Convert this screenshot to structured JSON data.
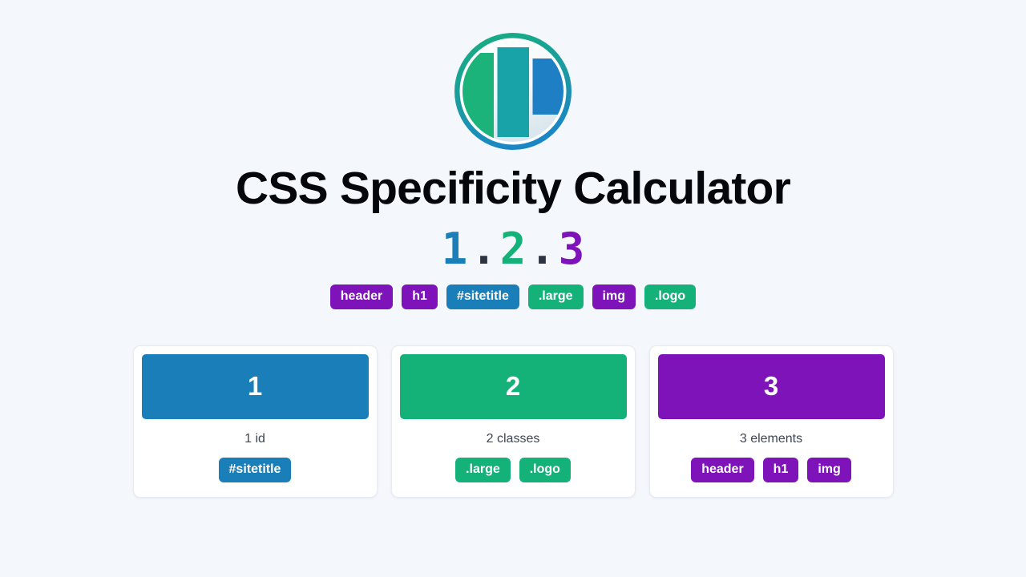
{
  "colors": {
    "background": "#f4f7fc",
    "id_blue": "#1a7fb8",
    "class_green": "#14b179",
    "element_purple": "#7f13ba",
    "separator": "#2d3340",
    "title": "#05070c",
    "card_label": "#3d4654",
    "card_bg": "#ffffff",
    "card_border": "#e6eaf1",
    "logo_ring_top": "#17b07d",
    "logo_ring_bottom": "#1b86c4",
    "logo_bar_green": "#1bb37a",
    "logo_bar_teal": "#17a3a8",
    "logo_bar_blue": "#1f7fc4",
    "logo_inner_top": "#ffffff",
    "logo_inner_bottom": "#dfe9ef"
  },
  "logo": {
    "icon": "specificity-bars-logo",
    "bars": [
      {
        "name": "bar-green",
        "color": "#1bb37a"
      },
      {
        "name": "bar-teal",
        "color": "#17a3a8"
      },
      {
        "name": "bar-blue",
        "color": "#1f7fc4"
      }
    ]
  },
  "header": {
    "title": "CSS Specificity Calculator"
  },
  "score": {
    "ids": "1",
    "classes": "2",
    "elements": "3",
    "separator": ".",
    "full": "1.2.3"
  },
  "selectors": [
    {
      "label": "header",
      "type": "element",
      "color": "#7f13ba"
    },
    {
      "label": "h1",
      "type": "element",
      "color": "#7f13ba"
    },
    {
      "label": "#sitetitle",
      "type": "id",
      "color": "#1a7fb8"
    },
    {
      "label": ".large",
      "type": "class",
      "color": "#14b179"
    },
    {
      "label": "img",
      "type": "element",
      "color": "#7f13ba"
    },
    {
      "label": ".logo",
      "type": "class",
      "color": "#14b179"
    }
  ],
  "cards": [
    {
      "count": "1",
      "label": "1 id",
      "color": "#1a7fb8",
      "type": "id",
      "tags": [
        {
          "label": "#sitetitle"
        }
      ]
    },
    {
      "count": "2",
      "label": "2 classes",
      "color": "#14b179",
      "type": "class",
      "tags": [
        {
          "label": ".large"
        },
        {
          "label": ".logo"
        }
      ]
    },
    {
      "count": "3",
      "label": "3 elements",
      "color": "#7f13ba",
      "type": "element",
      "tags": [
        {
          "label": "header"
        },
        {
          "label": "h1"
        },
        {
          "label": "img"
        }
      ]
    }
  ]
}
